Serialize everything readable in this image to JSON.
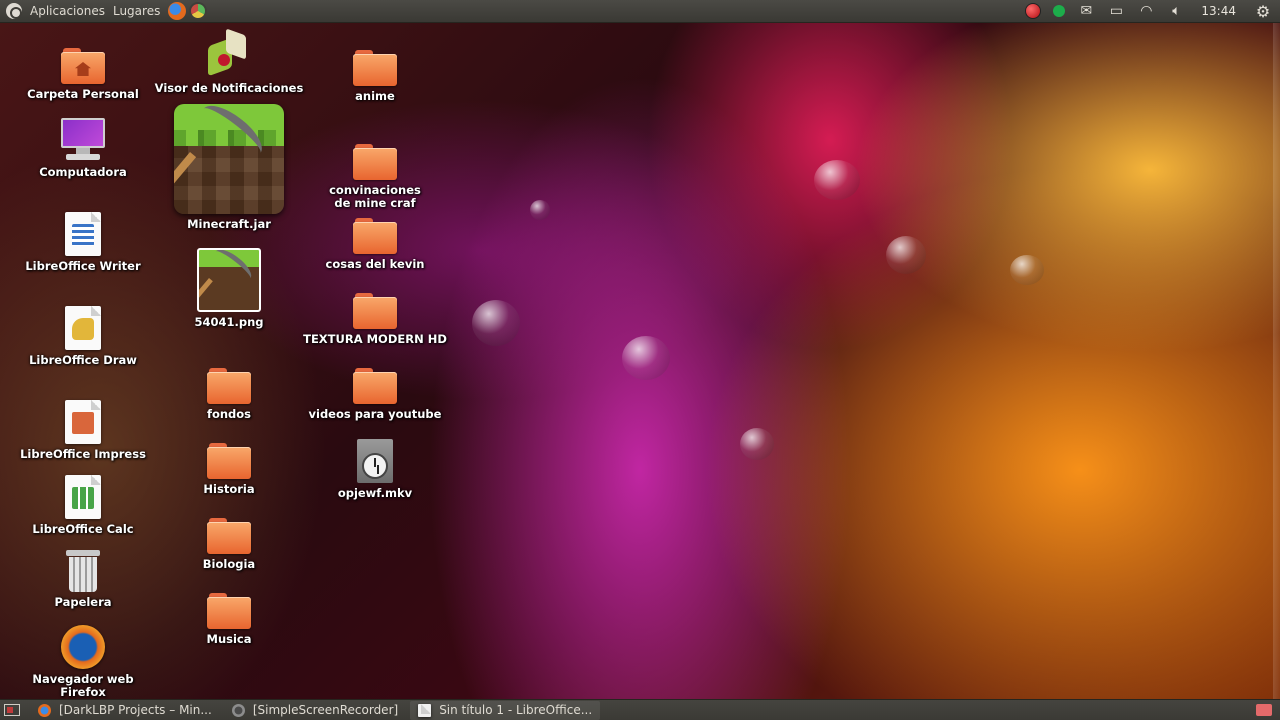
{
  "top_panel": {
    "menu_applications": "Aplicaciones",
    "menu_places": "Lugares",
    "clock": "13:44"
  },
  "desktop": {
    "col1": {
      "home": "Carpeta Personal",
      "computer": "Computadora",
      "writer": "LibreOffice Writer",
      "draw": "LibreOffice Draw",
      "impress": "LibreOffice Impress",
      "calc": "LibreOffice Calc",
      "trash": "Papelera",
      "firefox": "Navegador web Firefox"
    },
    "col2": {
      "notifications": "Visor de Notificaciones",
      "minecraft_jar": "Minecraft.jar",
      "png": "54041.png",
      "fondos": "fondos",
      "historia": "Historia",
      "biologia": "Biologia",
      "musica": "Musica"
    },
    "col3": {
      "anime": "anime",
      "convinaciones": "convinaciones de mine craf",
      "kevin": "cosas del kevin",
      "textura": "TEXTURA MODERN HD",
      "videos": "videos para youtube",
      "mkv": "opjewf.mkv"
    }
  },
  "taskbar": {
    "tasks": [
      {
        "label": "[DarkLBP Projects – Min..."
      },
      {
        "label": "[SimpleScreenRecorder]"
      },
      {
        "label": "Sin título 1 - LibreOffice..."
      }
    ]
  },
  "colors": {
    "panel": "#3f3e39",
    "folder": "#f08a4b",
    "label_text": "#ffffff"
  }
}
